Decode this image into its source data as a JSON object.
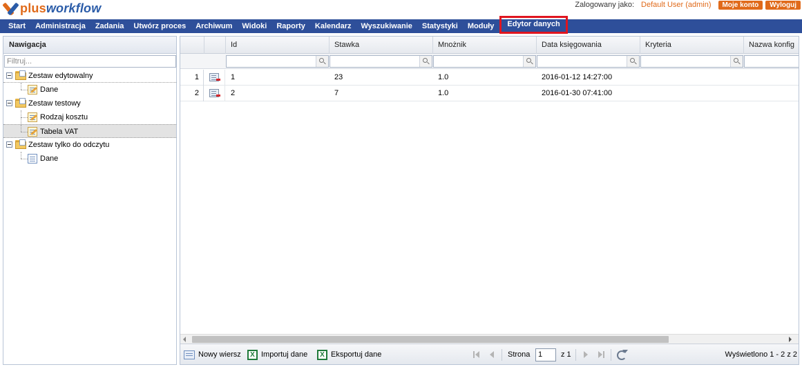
{
  "header": {
    "logo_part1": "plus",
    "logo_part2": "workflow",
    "logged_label": "Zalogowany jako:",
    "user_name": "Default User (admin)",
    "account_button": "Moje konto",
    "logout_button": "Wyloguj"
  },
  "menu": [
    {
      "label": "Start"
    },
    {
      "label": "Administracja"
    },
    {
      "label": "Zadania"
    },
    {
      "label": "Utwórz proces"
    },
    {
      "label": "Archiwum"
    },
    {
      "label": "Widoki"
    },
    {
      "label": "Raporty"
    },
    {
      "label": "Kalendarz"
    },
    {
      "label": "Wyszukiwanie"
    },
    {
      "label": "Statystyki"
    },
    {
      "label": "Moduły"
    },
    {
      "label": "Edytor danych",
      "highlighted": true
    }
  ],
  "nav": {
    "title": "Nawigacja",
    "filter_placeholder": "Filtruj...",
    "tree": [
      {
        "label": "Zestaw edytowalny",
        "children": [
          {
            "label": "Dane",
            "icon": "edit-table-icon"
          }
        ]
      },
      {
        "label": "Zestaw testowy",
        "children": [
          {
            "label": "Rodzaj kosztu",
            "icon": "edit-table-icon"
          },
          {
            "label": "Tabela VAT",
            "icon": "edit-table-icon",
            "selected": true
          }
        ]
      },
      {
        "label": "Zestaw tylko do odczytu",
        "children": [
          {
            "label": "Dane",
            "icon": "table-icon"
          }
        ]
      }
    ]
  },
  "grid": {
    "columns": [
      "Id",
      "Stawka",
      "Mnożnik",
      "Data księgowania",
      "Kryteria",
      "Nazwa konfig"
    ],
    "rows": [
      {
        "num": "1",
        "id": "1",
        "stawka": "23",
        "mnoznik": "1.0",
        "data": "2016-01-12 14:27:00",
        "kryteria": ""
      },
      {
        "num": "2",
        "id": "2",
        "stawka": "7",
        "mnoznik": "1.0",
        "data": "2016-01-30 07:41:00",
        "kryteria": ""
      }
    ]
  },
  "footer": {
    "new_row": "Nowy wiersz",
    "import": "Importuj dane",
    "export": "Eksportuj dane",
    "page_label": "Strona",
    "page_value": "1",
    "page_of": "z 1",
    "display_info": "Wyświetlono 1 - 2 z 2"
  },
  "colors": {
    "menu_bg": "#2e4f9a",
    "accent": "#e06a1a",
    "highlight_border": "#e0151f"
  }
}
